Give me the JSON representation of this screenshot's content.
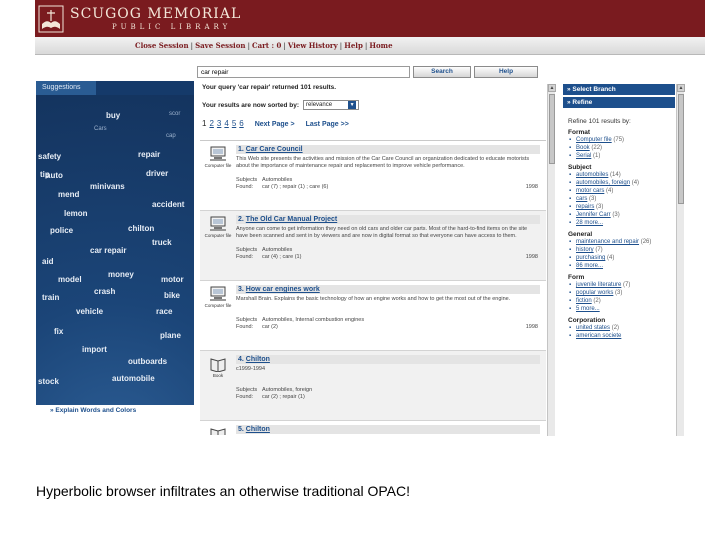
{
  "header": {
    "logo_title": "SCUGOG MEMORIAL",
    "logo_subtitle": "PUBLIC LIBRARY",
    "nav": [
      "Close Session",
      "Save Session",
      "Cart : 0",
      "View History",
      "Help",
      "Home"
    ],
    "brand_color": "#7a1b1f"
  },
  "viz": {
    "tab_label": "Suggestions",
    "footer_link": "» Explain Words and Colors",
    "words": [
      {
        "text": "buy",
        "size": "big"
      },
      {
        "text": "scor",
        "size": "small"
      },
      {
        "text": "Cars",
        "size": "small"
      },
      {
        "text": "cap",
        "size": "small"
      },
      {
        "text": "safety",
        "size": "big"
      },
      {
        "text": "repair",
        "size": "big"
      },
      {
        "text": "tip",
        "size": "big"
      },
      {
        "text": "auto",
        "size": "big"
      },
      {
        "text": "driver",
        "size": "big"
      },
      {
        "text": "minivans",
        "size": "big"
      },
      {
        "text": "mend",
        "size": "big"
      },
      {
        "text": "accident",
        "size": "big"
      },
      {
        "text": "lemon",
        "size": "big"
      },
      {
        "text": "police",
        "size": "big"
      },
      {
        "text": "chilton",
        "size": "big"
      },
      {
        "text": "truck",
        "size": "big"
      },
      {
        "text": "car repair",
        "size": "big"
      },
      {
        "text": "aid",
        "size": "big"
      },
      {
        "text": "money",
        "size": "big"
      },
      {
        "text": "model",
        "size": "big"
      },
      {
        "text": "motor",
        "size": "big"
      },
      {
        "text": "crash",
        "size": "big"
      },
      {
        "text": "train",
        "size": "big"
      },
      {
        "text": "bike",
        "size": "big"
      },
      {
        "text": "vehicle",
        "size": "big"
      },
      {
        "text": "race",
        "size": "big"
      },
      {
        "text": "fix",
        "size": "big"
      },
      {
        "text": "plane",
        "size": "big"
      },
      {
        "text": "import",
        "size": "big"
      },
      {
        "text": "outboards",
        "size": "big"
      },
      {
        "text": "stock",
        "size": "big"
      },
      {
        "text": "automobile",
        "size": "big"
      }
    ]
  },
  "search": {
    "query": "car repair",
    "search_label": "Search",
    "help_label": "Help",
    "summary": "Your query 'car repair' returned 101 results.",
    "sort_label": "Your results are now sorted by:",
    "sort_value": "relevance",
    "pages": [
      "1",
      "2",
      "3",
      "4",
      "5",
      "6"
    ],
    "current_page": "1",
    "next_label": "Next Page >",
    "last_label": "Last Page >>"
  },
  "results": [
    {
      "num": "1.",
      "title": "Car Care Council",
      "icon": "computer-file-icon",
      "icon_label": "Computer file",
      "desc": "This Web site presents the activities and mission of the Car Care Council an organization dedicated to educate motorists about the importance of maintenance repair and replacement to improve vehicle performance.",
      "subjects": "Automobiles",
      "found": "car (7) ; repair (1) ; care (6)",
      "year": "1998"
    },
    {
      "num": "2.",
      "title": "The Old Car Manual Project",
      "icon": "computer-file-icon",
      "icon_label": "Computer file",
      "desc": "Anyone can come to get information they need on old cars and older car parts. Most of the hard-to-find items on the site have been scanned and sent in by viewers and are now in digital format so that everyone can have access to them.",
      "subjects": "Automobiles",
      "found": "car (4) ; care (1)",
      "year": "1998"
    },
    {
      "num": "3.",
      "title": "How car engines work",
      "icon": "computer-file-icon",
      "icon_label": "Computer file",
      "desc": "Marshall Brain. Explains the basic technology of how an engine works and how to get the most out of the engine.",
      "subjects": "Automobiles, Internal combustion engines",
      "found": "car (2)",
      "year": "1998"
    },
    {
      "num": "4.",
      "title": "Chilton",
      "icon": "book-icon",
      "icon_label": "Book",
      "desc": "c1999-1994",
      "subjects": "Automobiles, foreign",
      "found": "car (2) ; repair (1)",
      "year": ""
    },
    {
      "num": "5.",
      "title": "Chilton",
      "icon": "book-icon",
      "icon_label": "Book",
      "desc": "",
      "subjects": "",
      "found": "",
      "year": ""
    }
  ],
  "labels": {
    "subjects": "Subjects",
    "found": "Found:"
  },
  "refine": {
    "select_branch": "» Select Branch",
    "refine_label": "» Refine",
    "refine_count": "Refine 101 results by:",
    "facets": [
      {
        "head": "Format",
        "items": [
          {
            "v": "Computer file",
            "c": "(75)"
          },
          {
            "v": "Book",
            "c": "(22)"
          },
          {
            "v": "Serial",
            "c": "(1)"
          }
        ]
      },
      {
        "head": "Subject",
        "items": [
          {
            "v": "automobiles",
            "c": "(14)"
          },
          {
            "v": "automobiles, foreign",
            "c": "(4)"
          },
          {
            "v": "motor cars",
            "c": "(4)"
          },
          {
            "v": "cars",
            "c": "(3)"
          },
          {
            "v": "repairs",
            "c": "(3)"
          },
          {
            "v": "Jennifer Carr",
            "c": "(3)"
          },
          {
            "v": "28 more...",
            "c": ""
          }
        ]
      },
      {
        "head": "General",
        "items": [
          {
            "v": "maintenance and repair",
            "c": "(26)"
          },
          {
            "v": "history",
            "c": "(7)"
          },
          {
            "v": "purchasing",
            "c": "(4)"
          },
          {
            "v": "86 more...",
            "c": ""
          }
        ]
      },
      {
        "head": "Form",
        "items": [
          {
            "v": "juvenile literature",
            "c": "(7)"
          },
          {
            "v": "popular works",
            "c": "(3)"
          },
          {
            "v": "fiction",
            "c": "(2)"
          },
          {
            "v": "5 more...",
            "c": ""
          }
        ]
      },
      {
        "head": "Corporation",
        "items": [
          {
            "v": "united states",
            "c": "(2)"
          },
          {
            "v": "american societe",
            "c": ""
          }
        ]
      }
    ]
  },
  "caption": "Hyperbolic browser infiltrates an otherwise traditional OPAC!"
}
